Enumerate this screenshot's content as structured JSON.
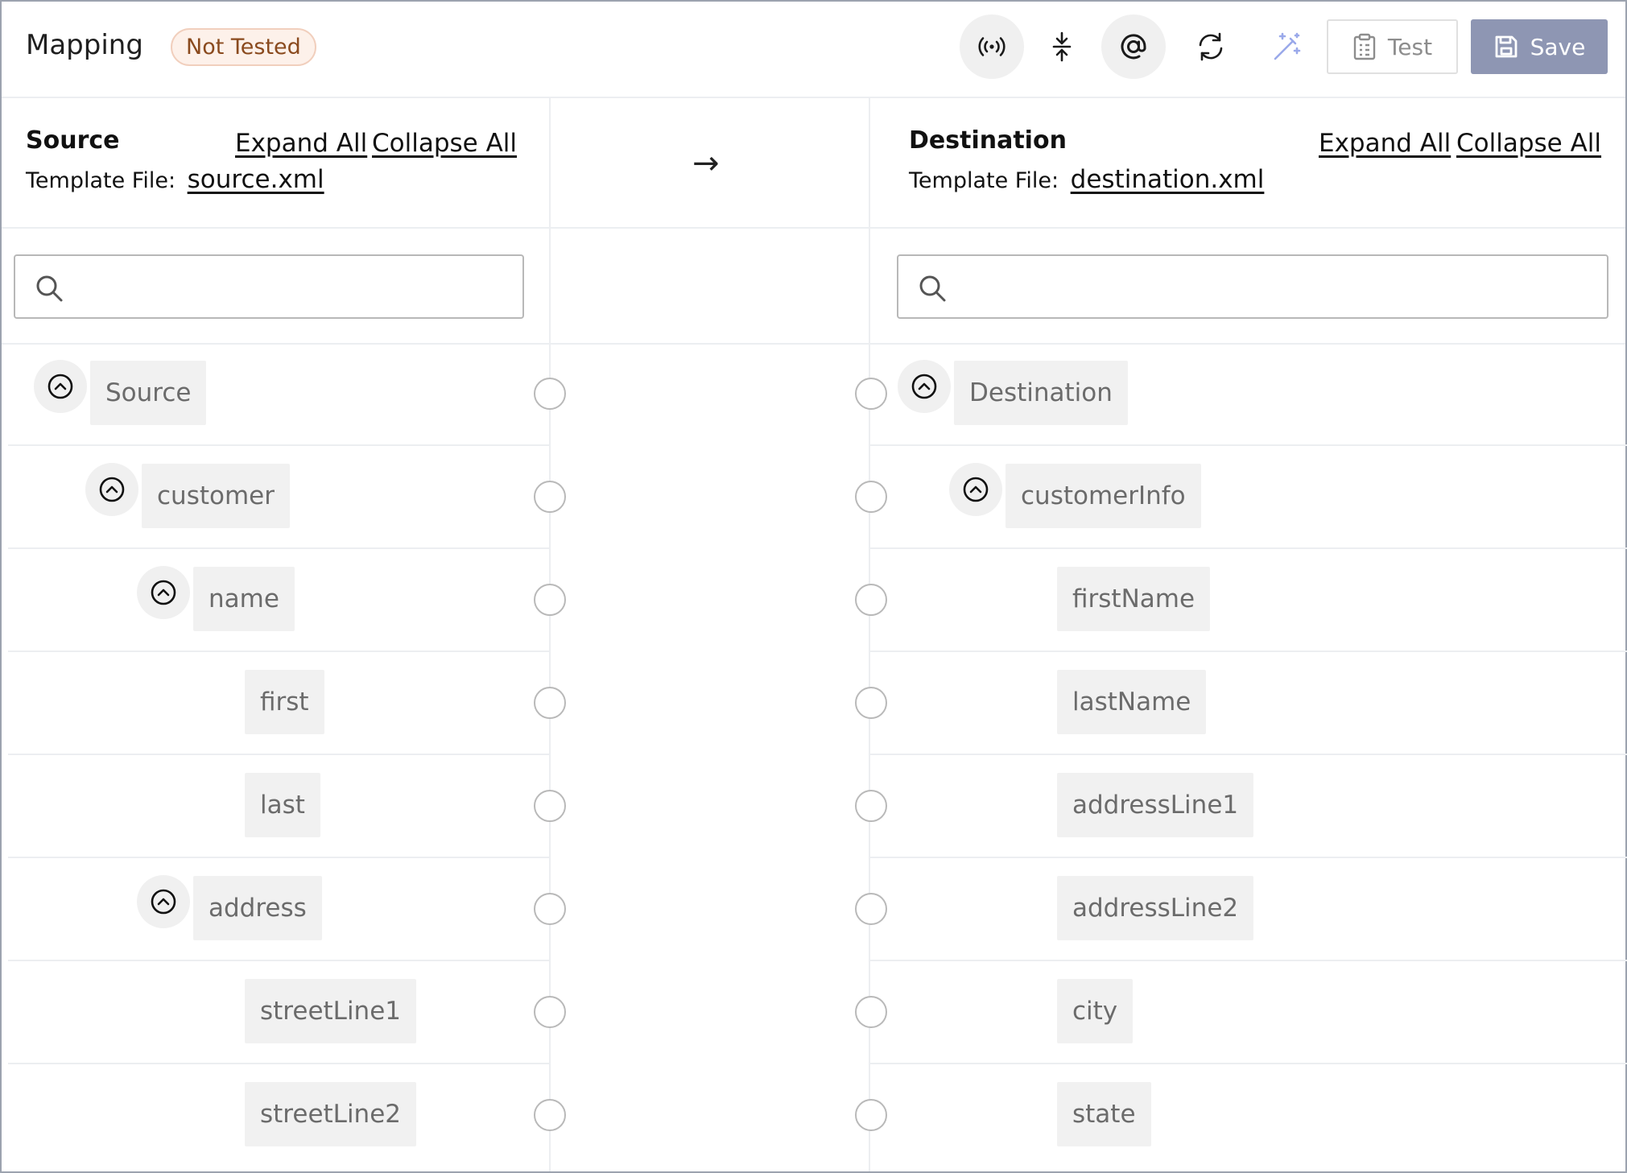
{
  "header": {
    "title": "Mapping",
    "status_badge": "Not Tested",
    "toolbar_icons": [
      "broadcast-icon",
      "compress-vertical-icon",
      "at-sign-icon",
      "refresh-icon",
      "magic-wand-icon"
    ],
    "test_label": "Test",
    "save_label": "Save"
  },
  "source": {
    "title": "Source",
    "template_label": "Template File:",
    "template_file": "source.xml",
    "expand_all": "Expand All",
    "collapse_all": "Collapse All",
    "search_value": "",
    "tree": [
      {
        "label": "Source",
        "level": 0,
        "expandable": true
      },
      {
        "label": "customer",
        "level": 1,
        "expandable": true
      },
      {
        "label": "name",
        "level": 2,
        "expandable": true
      },
      {
        "label": "first",
        "level": 3,
        "expandable": false
      },
      {
        "label": "last",
        "level": 3,
        "expandable": false
      },
      {
        "label": "address",
        "level": 2,
        "expandable": true
      },
      {
        "label": "streetLine1",
        "level": 3,
        "expandable": false
      },
      {
        "label": "streetLine2",
        "level": 3,
        "expandable": false
      }
    ]
  },
  "arrow": "→",
  "destination": {
    "title": "Destination",
    "template_label": "Template File:",
    "template_file": "destination.xml",
    "expand_all": "Expand All",
    "collapse_all": "Collapse All",
    "search_value": "",
    "tree": [
      {
        "label": "Destination",
        "level": 0,
        "expandable": true
      },
      {
        "label": "customerInfo",
        "level": 1,
        "expandable": true
      },
      {
        "label": "firstName",
        "level": 2,
        "expandable": false
      },
      {
        "label": "lastName",
        "level": 2,
        "expandable": false
      },
      {
        "label": "addressLine1",
        "level": 2,
        "expandable": false
      },
      {
        "label": "addressLine2",
        "level": 2,
        "expandable": false
      },
      {
        "label": "city",
        "level": 2,
        "expandable": false
      },
      {
        "label": "state",
        "level": 2,
        "expandable": false
      }
    ]
  },
  "colors": {
    "save_button": "#8e96b3",
    "badge_background": "#fdf1ea",
    "badge_text": "#8a4a1e",
    "magic_icon": "#9aa9ea"
  }
}
